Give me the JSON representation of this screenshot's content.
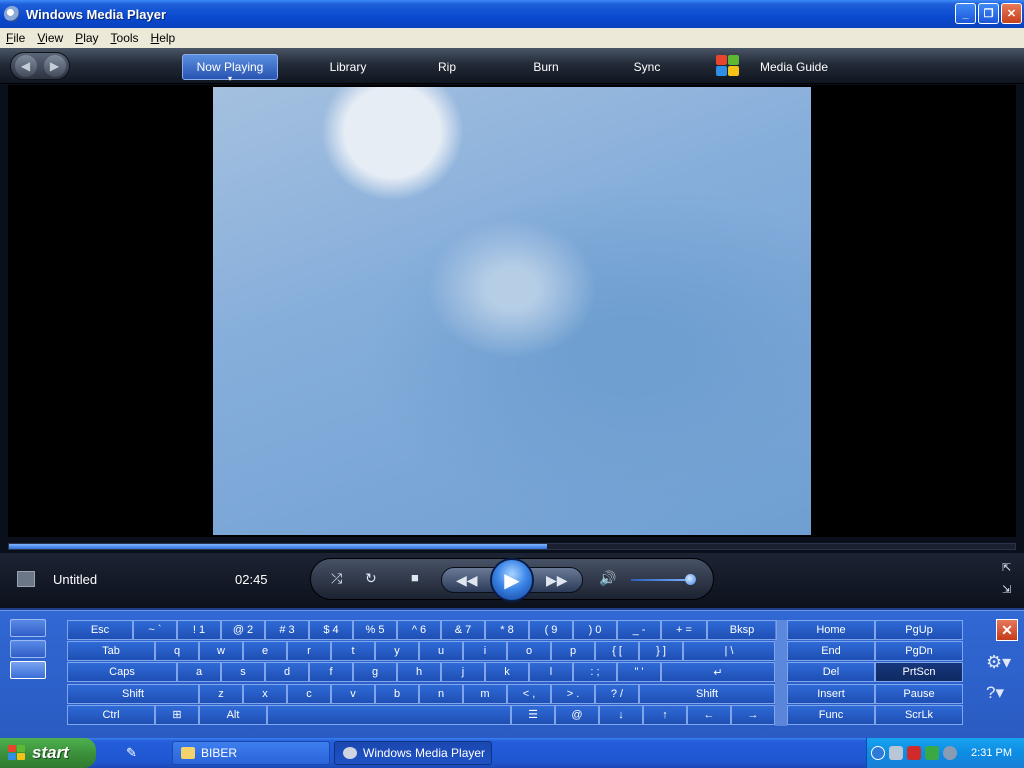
{
  "window": {
    "title": "Windows Media Player"
  },
  "menu": [
    "File",
    "View",
    "Play",
    "Tools",
    "Help"
  ],
  "nav": {
    "tabs": [
      "Now Playing",
      "Library",
      "Rip",
      "Burn",
      "Sync",
      "Media Guide"
    ],
    "active_tab": "Now Playing"
  },
  "player": {
    "track_title": "Untitled",
    "elapsed": "02:45",
    "seek_fraction": 0.535,
    "volume_fraction": 0.95
  },
  "keyboard": {
    "row1": [
      "Esc",
      "~ `",
      "! 1",
      "@ 2",
      "# 3",
      "$ 4",
      "% 5",
      "^ 6",
      "& 7",
      "* 8",
      "( 9",
      ") 0",
      "_ -",
      "+ =",
      "Bksp",
      "Home",
      "PgUp"
    ],
    "row2": [
      "Tab",
      "q",
      "w",
      "e",
      "r",
      "t",
      "y",
      "u",
      "i",
      "o",
      "p",
      "{ [",
      "} ]",
      "| \\",
      "End",
      "PgDn"
    ],
    "row3": [
      "Caps",
      "a",
      "s",
      "d",
      "f",
      "g",
      "h",
      "j",
      "k",
      "l",
      ": ;",
      "\" '",
      "↵",
      "Del",
      "PrtScn"
    ],
    "row4": [
      "Shift",
      "z",
      "x",
      "c",
      "v",
      "b",
      "n",
      "m",
      "< ,",
      "> .",
      "? /",
      "Shift",
      "Insert",
      "Pause"
    ],
    "row5": [
      "Ctrl",
      "⊞",
      "Alt",
      "",
      "☰",
      "@",
      "↓",
      "↑",
      "←",
      "→",
      "Func",
      "ScrLk"
    ]
  },
  "taskbar": {
    "start_label": "start",
    "buttons": [
      "BIBER",
      "Windows Media Player"
    ],
    "clock": "2:31 PM"
  },
  "colors": {
    "accent": "#2f5fc6",
    "video": "#86aedb"
  }
}
